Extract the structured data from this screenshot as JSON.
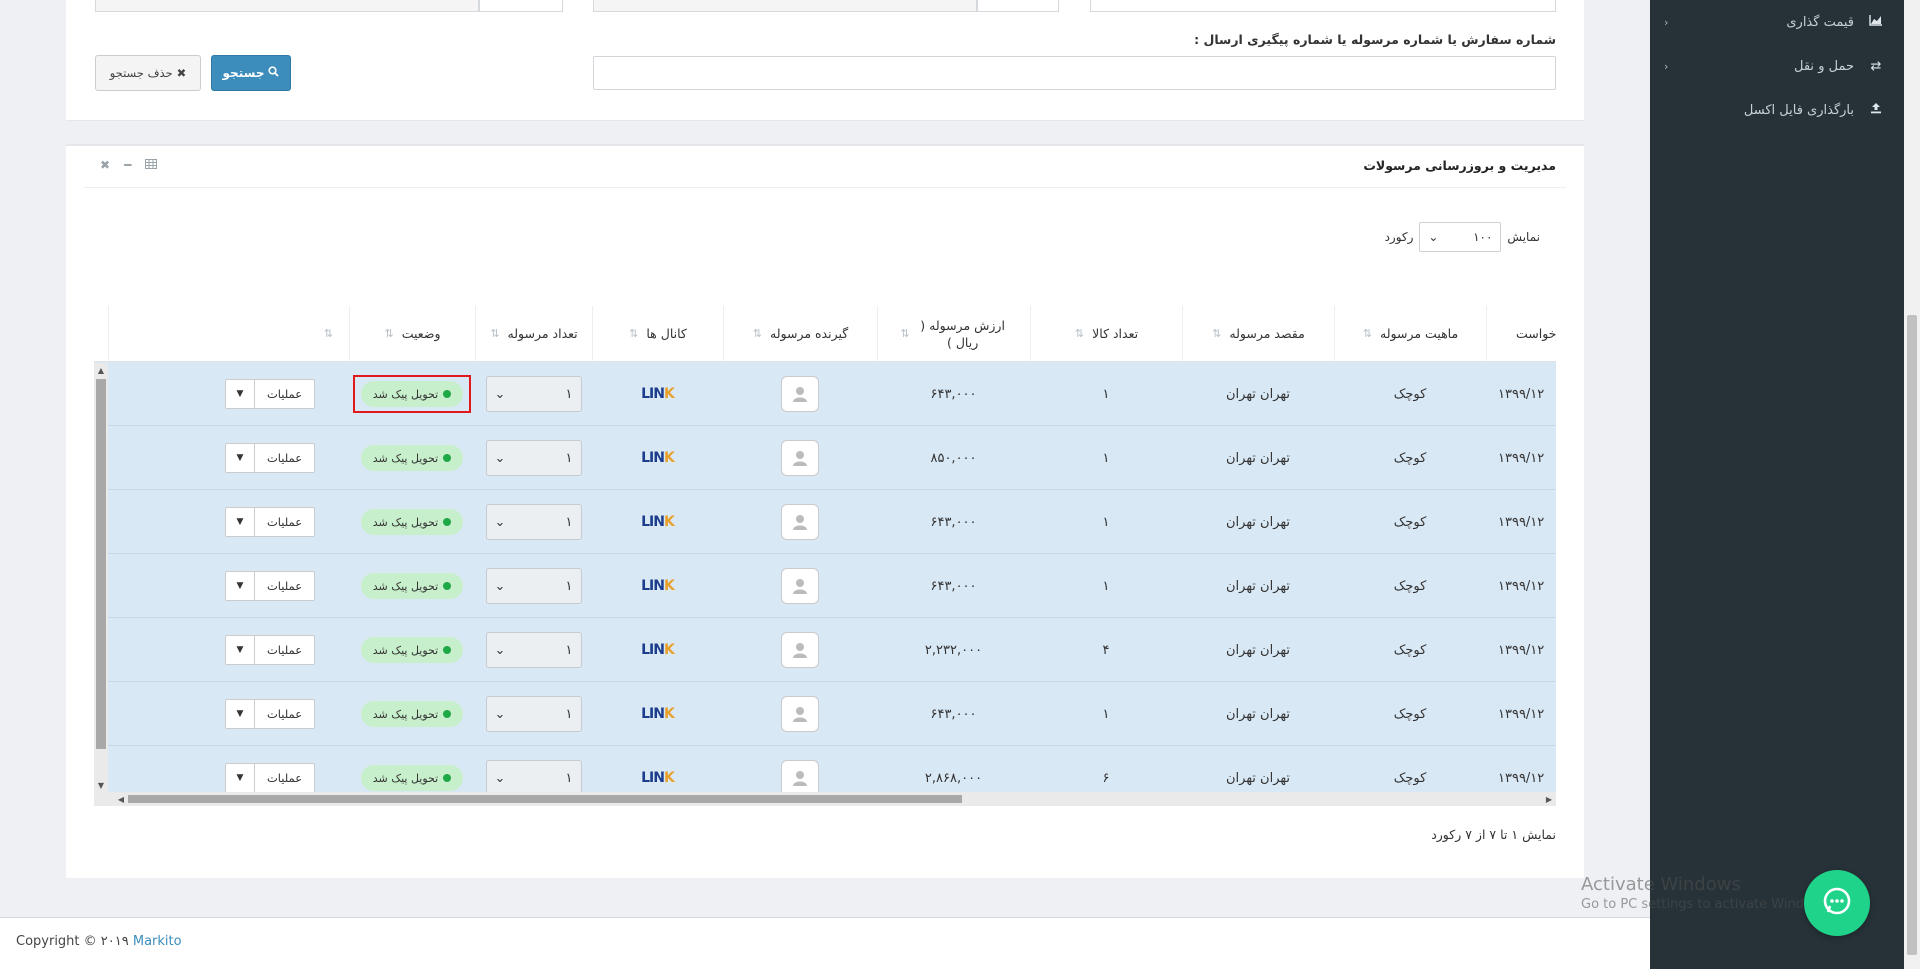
{
  "sidebar": {
    "items": [
      {
        "label": "قیمت گذاری",
        "icon": "area-chart-icon",
        "chevron": "‹"
      },
      {
        "label": "حمل و نقل",
        "icon": "exchange-icon",
        "chevron": "‹"
      },
      {
        "label": "بارگذاری فایل اکسل",
        "icon": "upload-icon",
        "chevron": ""
      }
    ]
  },
  "search": {
    "order_label": "شماره سفارش یا شماره مرسوله یا شماره پیگیری ارسال :",
    "order_value": "",
    "search_button": "جستجو",
    "clear_button": "حذف جستجو"
  },
  "panel": {
    "title": "مدیریت و بروزرسانی مرسولات",
    "length_prefix": "نمایش",
    "length_value": "۱۰۰",
    "length_suffix": "رکورد",
    "info": "نمایش ۱ تا ۷ از ۷ رکورد"
  },
  "table": {
    "columns": [
      "درخواست",
      "ماهیت مرسوله",
      "مقصد مرسوله",
      "تعداد کالا",
      "ارزش مرسوله ( ریال )",
      "گیرنده مرسوله",
      "کانال ها",
      "تعداد مرسوله",
      "وضعیت",
      ""
    ],
    "rows": [
      {
        "date": "۱۳۹۹/۱۲",
        "type": "کوچک",
        "destination": "تهران تهران",
        "items": "۱",
        "value": "۶۴۳,۰۰۰",
        "channel": "LINK",
        "count": "۱",
        "status": "تحویل پیک شد",
        "ops": "عملیات"
      },
      {
        "date": "۱۳۹۹/۱۲",
        "type": "کوچک",
        "destination": "تهران تهران",
        "items": "۱",
        "value": "۸۵۰,۰۰۰",
        "channel": "LINK",
        "count": "۱",
        "status": "تحویل پیک شد",
        "ops": "عملیات"
      },
      {
        "date": "۱۳۹۹/۱۲",
        "type": "کوچک",
        "destination": "تهران تهران",
        "items": "۱",
        "value": "۶۴۳,۰۰۰",
        "channel": "LINK",
        "count": "۱",
        "status": "تحویل پیک شد",
        "ops": "عملیات"
      },
      {
        "date": "۱۳۹۹/۱۲",
        "type": "کوچک",
        "destination": "تهران تهران",
        "items": "۱",
        "value": "۶۴۳,۰۰۰",
        "channel": "LINK",
        "count": "۱",
        "status": "تحویل پیک شد",
        "ops": "عملیات"
      },
      {
        "date": "۱۳۹۹/۱۲",
        "type": "کوچک",
        "destination": "تهران تهران",
        "items": "۴",
        "value": "۲,۲۳۲,۰۰۰",
        "channel": "LINK",
        "count": "۱",
        "status": "تحویل پیک شد",
        "ops": "عملیات"
      },
      {
        "date": "۱۳۹۹/۱۲",
        "type": "کوچک",
        "destination": "تهران تهران",
        "items": "۱",
        "value": "۶۴۳,۰۰۰",
        "channel": "LINK",
        "count": "۱",
        "status": "تحویل پیک شد",
        "ops": "عملیات"
      },
      {
        "date": "۱۳۹۹/۱۲",
        "type": "کوچک",
        "destination": "تهران تهران",
        "items": "۶",
        "value": "۲,۸۶۸,۰۰۰",
        "channel": "LINK",
        "count": "۱",
        "status": "تحویل پیک شد",
        "ops": "عملیات"
      }
    ]
  },
  "footer": {
    "copyright": "Copyright © ۲۰۱۹ ",
    "brand": "Markito"
  },
  "watermark": {
    "line1": "Activate Windows",
    "line2": "Go to PC settings to activate Windows."
  },
  "colors": {
    "sidebar": "#263238",
    "primary": "#3c8dbc",
    "row": "#d9e8f5",
    "status_bg": "#c8efcc",
    "status_dot": "#1fa846",
    "highlight": "#e0191f",
    "chat": "#1fd38a"
  }
}
